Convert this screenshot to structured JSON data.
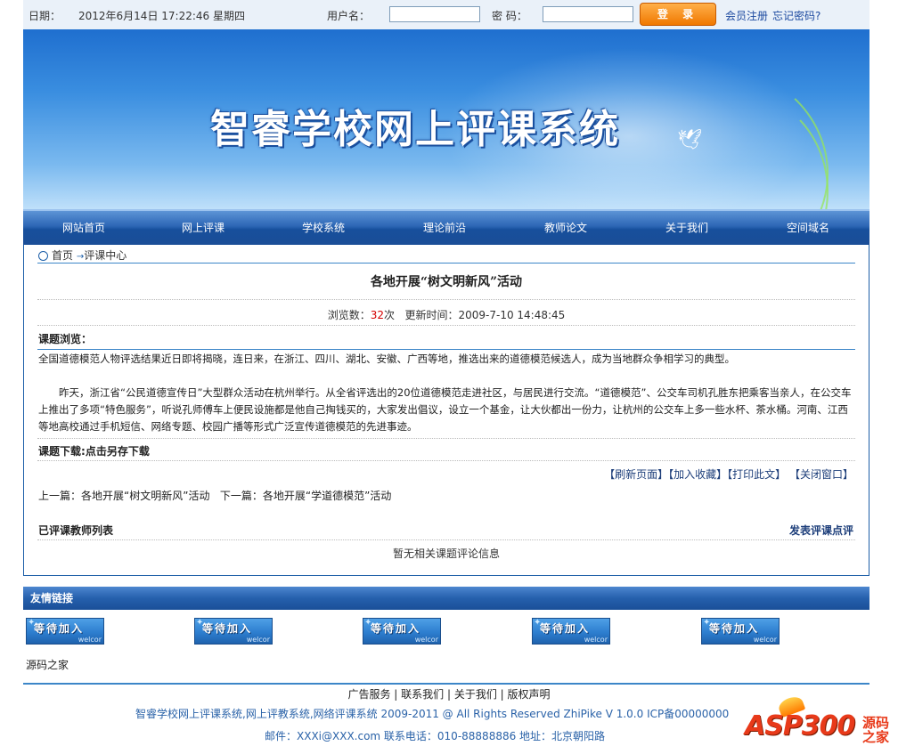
{
  "topbar": {
    "date_label": "日期：",
    "date_value": "2012年6月14日 17:22:46 星期四",
    "username_label": "用户名：",
    "password_label": "密 码：",
    "login_button": "登 录",
    "register_link": "会员注册",
    "forgot_link": "忘记密码?"
  },
  "banner": {
    "title": "智睿学校网上评课系统"
  },
  "nav": {
    "items": [
      {
        "label": "网站首页"
      },
      {
        "label": "网上评课"
      },
      {
        "label": "学校系统"
      },
      {
        "label": "理论前沿"
      },
      {
        "label": "教师论文"
      },
      {
        "label": "关于我们"
      },
      {
        "label": "空间域名"
      }
    ]
  },
  "breadcrumb": {
    "home": "首页",
    "current": "评课中心"
  },
  "article": {
    "title": "各地开展“树文明新风”活动",
    "views_label": "浏览数：",
    "views_count": "32",
    "views_unit": "次",
    "updated_label": "更新时间：",
    "updated_value": "2009-7-10 14:48:45",
    "preview_label": "课题浏览：",
    "para1": "全国道德模范人物评选结果近日即将揭晓，连日来，在浙江、四川、湖北、安徽、广西等地，推选出来的道德模范候选人，成为当地群众争相学习的典型。",
    "para2": "　　昨天，浙江省“公民道德宣传日”大型群众活动在杭州举行。从全省评选出的20位道德模范走进社区，与居民进行交流。“道德模范”、公交车司机孔胜东把乘客当亲人，在公交车上推出了多项“特色服务”，听说孔师傅车上便民设施都是他自己掏钱买的，大家发出倡议，设立一个基金，让大伙都出一份力，让杭州的公交车上多一些水杯、茶水桶。河南、江西等地高校通过手机短信、网络专题、校园广播等形式广泛宣传道德模范的先进事迹。",
    "download_label": "课题下载:",
    "download_link": "点击另存下载"
  },
  "actions": {
    "refresh": "【刷新页面】",
    "favorite": "【加入收藏】",
    "print": "【打印此文】",
    "close": "【关闭窗口】"
  },
  "prevnext": {
    "prev_label": "上一篇：",
    "prev_title": "各地开展“树文明新风”活动",
    "next_label": "下一篇：",
    "next_title": "各地开展“学道德模范”活动"
  },
  "reviews": {
    "list_title": "已评课教师列表",
    "post_link": "发表评课点评",
    "empty_text": "暂无相关课题评论信息"
  },
  "friends": {
    "title": "友情链接",
    "badges": [
      {
        "text": "等待加入",
        "sub": "welcor"
      },
      {
        "text": "等待加入",
        "sub": "welcor"
      },
      {
        "text": "等待加入",
        "sub": "welcor"
      },
      {
        "text": "等待加入",
        "sub": "welcor"
      },
      {
        "text": "等待加入",
        "sub": "welcor"
      }
    ],
    "text_link": "源码之家"
  },
  "footer": {
    "links": [
      "广告服务",
      "联系我们",
      "关于我们",
      "版权声明"
    ],
    "copyright": "智睿学校网上评课系统,网上评教系统,网络评课系统  2009-2011 @ All Rights Reserved ZhiPike V 1.0.0 ICP备00000000",
    "contact": "邮件：XXXi@XXX.com 联系电话：010-88888886    地址：北京朝阳路",
    "logo_text": "ASP300",
    "logo_sub1": "源码",
    "logo_sub2": "之家"
  },
  "colors": {
    "nav_blue": "#1a4e97",
    "accent_orange": "#f07800",
    "link_blue": "#1d3e7a",
    "count_red": "#d40000"
  }
}
